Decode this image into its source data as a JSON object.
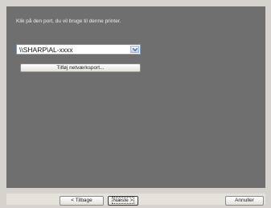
{
  "instruction": "Klik på den port, du vil bruge til denne printer.",
  "port_select": {
    "value": "\\\\SHARP\\AL-xxxx"
  },
  "buttons": {
    "add_port": "Tilføj netværksport...",
    "back": "< Tilbage",
    "next": "Næste >",
    "cancel": "Annuller"
  },
  "icons": {
    "dropdown": "chevron-down-icon"
  }
}
